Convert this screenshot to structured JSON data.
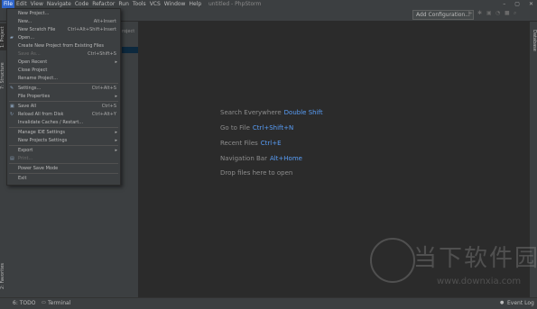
{
  "titlebar": {
    "menus": [
      "File",
      "Edit",
      "View",
      "Navigate",
      "Code",
      "Refactor",
      "Run",
      "Tools",
      "VCS",
      "Window",
      "Help"
    ],
    "app_title": "untitled - PhpStorm",
    "win_buttons": [
      "–",
      "▢",
      "✕"
    ]
  },
  "toolbar": {
    "add_configuration": "Add Configuration..."
  },
  "left_tabs": {
    "project": "1: Project",
    "structure": "7: Structure",
    "favorites": "2: Favorites"
  },
  "right_tabs": {
    "database": "Database"
  },
  "project_panel": {
    "header": "roject"
  },
  "file_menu": [
    {
      "label": "New Project...",
      "shortcut": ""
    },
    {
      "label": "New...",
      "shortcut": "Alt+Insert"
    },
    {
      "label": "New Scratch File",
      "shortcut": "Ctrl+Alt+Shift+Insert"
    },
    {
      "label": "Open...",
      "shortcut": ""
    },
    {
      "label": "Create New Project from Existing Files",
      "shortcut": ""
    },
    {
      "label": "Save As...",
      "shortcut": "Ctrl+Shift+S"
    },
    {
      "label": "Open Recent",
      "shortcut": ""
    },
    {
      "label": "Close Project",
      "shortcut": ""
    },
    {
      "label": "Rename Project...",
      "shortcut": ""
    },
    {
      "label": "Settings...",
      "shortcut": "Ctrl+Alt+S"
    },
    {
      "label": "File Properties",
      "shortcut": ""
    },
    {
      "label": "Save All",
      "shortcut": "Ctrl+S"
    },
    {
      "label": "Reload All from Disk",
      "shortcut": "Ctrl+Alt+Y"
    },
    {
      "label": "Invalidate Caches / Restart...",
      "shortcut": ""
    },
    {
      "label": "Manage IDE Settings",
      "shortcut": ""
    },
    {
      "label": "New Projects Settings",
      "shortcut": ""
    },
    {
      "label": "Export",
      "shortcut": ""
    },
    {
      "label": "Print...",
      "shortcut": ""
    },
    {
      "label": "Power Save Mode",
      "shortcut": ""
    },
    {
      "label": "Exit",
      "shortcut": ""
    }
  ],
  "editor_hints": [
    {
      "label": "Search Everywhere",
      "key": "Double Shift"
    },
    {
      "label": "Go to File",
      "key": "Ctrl+Shift+N"
    },
    {
      "label": "Recent Files",
      "key": "Ctrl+E"
    },
    {
      "label": "Navigation Bar",
      "key": "Alt+Home"
    },
    {
      "label": "Drop files here to open",
      "key": ""
    }
  ],
  "statusbar": {
    "todo": "6: TODO",
    "terminal": "Terminal",
    "event_log": "Event Log"
  },
  "watermark": {
    "text": "当下软件园",
    "url": "www.downxia.com"
  },
  "colors": {
    "accent": "#2f65ca",
    "hint_key": "#589df6",
    "panel": "#3c3f41",
    "editor": "#2b2b2b"
  }
}
